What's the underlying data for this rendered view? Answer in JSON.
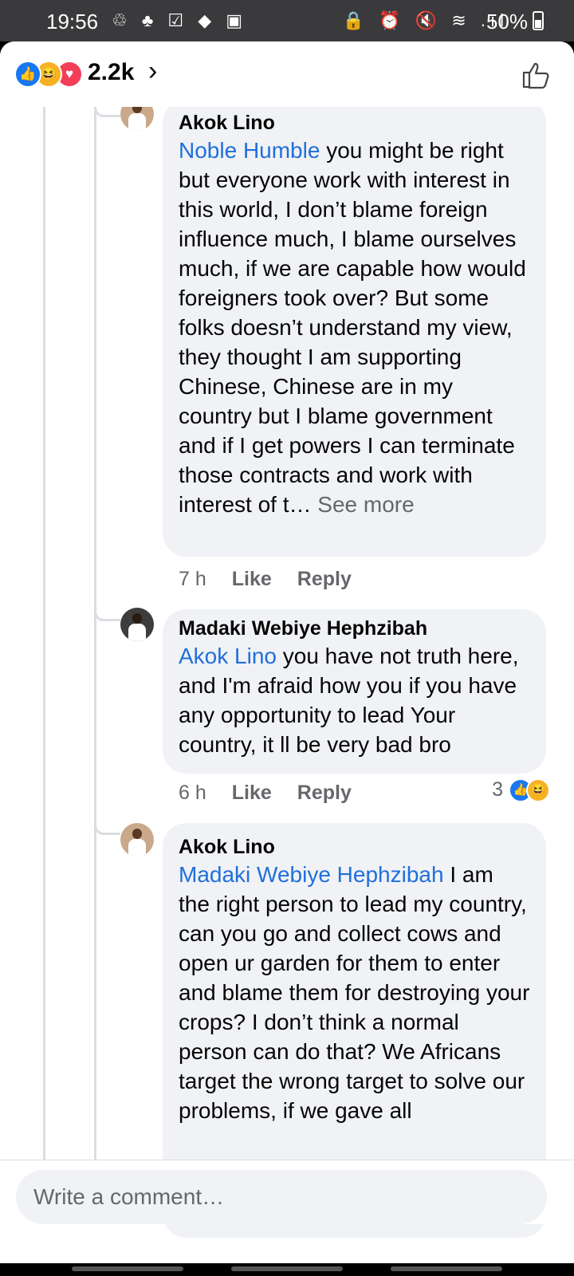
{
  "status_bar": {
    "time": "19:56",
    "battery": "50%",
    "left_icons": "♲ ♣ ☑ ◆ ▣",
    "right_icons": "🔒 ⏰ 🔇 ≋ .ıl"
  },
  "header": {
    "reaction_count": "2.2k",
    "reactions": [
      "like",
      "haha",
      "love"
    ]
  },
  "comments": [
    {
      "author": "Akok Lino",
      "mention": "Noble Humble",
      "text": " you might be right but everyone work with interest in this world, I don’t blame foreign influence much, I blame ourselves much, if we are capable how would foreigners took over? But some folks doesn’t understand my view, they thought I am supporting Chinese, Chinese are in my country but I blame government and if I get powers I can terminate those contracts and work with interest of t… ",
      "see_more": "See more",
      "time": "7 h",
      "like": "Like",
      "reply": "Reply"
    },
    {
      "author": "Madaki Webiye Hephzibah",
      "mention": "Akok Lino",
      "text": " you have not truth here, and I'm afraid how you if you have any opportunity to lead Your country, it ll be very bad bro",
      "time": "6 h",
      "like": "Like",
      "reply": "Reply",
      "reaction_count": "3"
    },
    {
      "author": "Akok Lino",
      "mention": "Madaki Webiye Hephzibah",
      "text": " I am the right person to lead my country, can you go and collect cows and open ur garden for them to enter and blame them for destroying your crops? I don’t think a normal person can do that? We Africans target the wrong target to solve our problems, if we gave all"
    }
  ],
  "composer": {
    "placeholder": "Write a comment…"
  }
}
